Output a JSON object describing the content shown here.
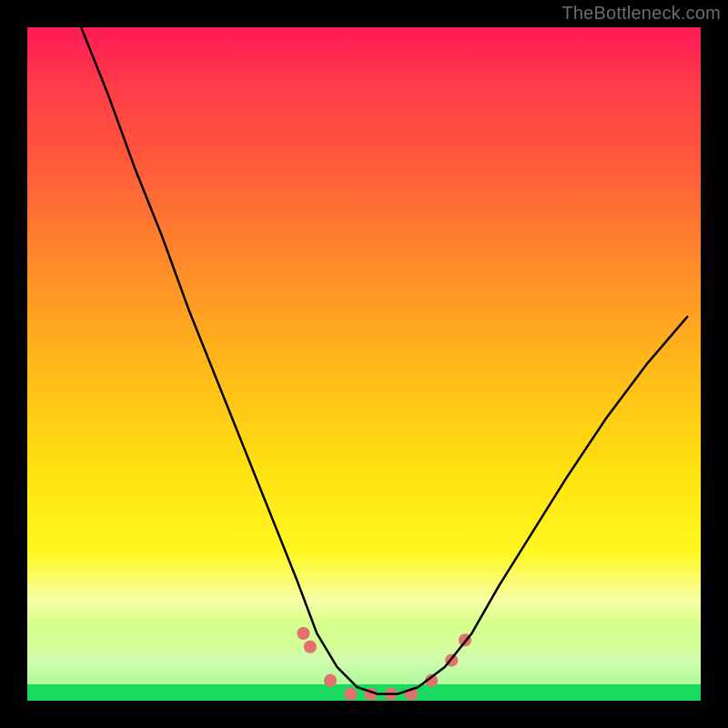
{
  "watermark": "TheBottleneck.com",
  "chart_data": {
    "type": "line",
    "title": "",
    "xlabel": "",
    "ylabel": "",
    "xlim": [
      0,
      100
    ],
    "ylim": [
      0,
      100
    ],
    "legend": false,
    "grid": false,
    "background_gradient": {
      "direction": "vertical",
      "stops": [
        {
          "pos": 0,
          "color": "#ff1a55"
        },
        {
          "pos": 50,
          "color": "#ffb81a"
        },
        {
          "pos": 80,
          "color": "#fff820"
        },
        {
          "pos": 100,
          "color": "#18da5e"
        }
      ]
    },
    "series": [
      {
        "name": "bottleneck-curve",
        "color": "#000000",
        "x": [
          8,
          12,
          16,
          20,
          24,
          28,
          32,
          36,
          40,
          43,
          46,
          49,
          52,
          55,
          58,
          62,
          66,
          70,
          75,
          80,
          86,
          92,
          98
        ],
        "values": [
          100,
          90,
          79,
          69,
          58,
          48,
          38,
          28,
          18,
          10,
          5,
          2,
          1,
          1,
          2,
          5,
          10,
          17,
          25,
          33,
          42,
          50,
          57
        ]
      }
    ],
    "markers": {
      "name": "highlight-dots",
      "color": "#e27070",
      "radius": 7,
      "points": [
        {
          "x": 41,
          "y": 10
        },
        {
          "x": 42,
          "y": 8
        },
        {
          "x": 45,
          "y": 3
        },
        {
          "x": 48,
          "y": 1
        },
        {
          "x": 51,
          "y": 1
        },
        {
          "x": 54,
          "y": 1
        },
        {
          "x": 57,
          "y": 1
        },
        {
          "x": 60,
          "y": 3
        },
        {
          "x": 63,
          "y": 6
        },
        {
          "x": 65,
          "y": 9
        }
      ]
    }
  }
}
